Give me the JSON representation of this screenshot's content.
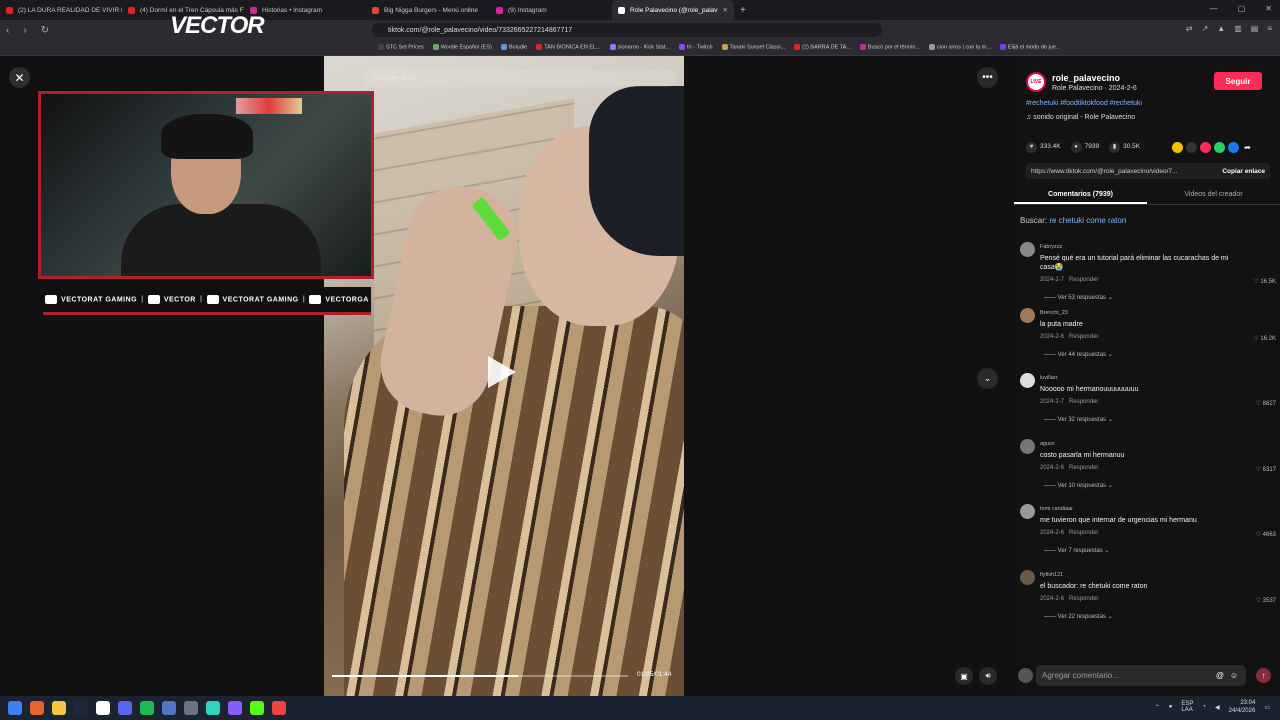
{
  "browser": {
    "tabs": [
      {
        "label": "(2) LA DURA REALIDAD DE VIVIR EN",
        "color": "#e02424"
      },
      {
        "label": "(4) Dormí en el Tren Cápsula más Fu",
        "color": "#e02424"
      },
      {
        "label": "Historias • Instagram",
        "color": "#d6249f"
      },
      {
        "label": "Big Nigga Burgers - Menú online",
        "color": "#e0453a"
      },
      {
        "label": "(9) Instagram",
        "color": "#d6249f"
      },
      {
        "label": "Role Palavecino (@role_palav",
        "color": "#ffffff"
      }
    ],
    "url": "tiktok.com/@role_palavecino/video/7332665227214867717",
    "bookmarks": [
      {
        "label": "STC Set Prices",
        "color": "#444"
      },
      {
        "label": "Wordle Español (ES)",
        "color": "#6aaa64"
      },
      {
        "label": "Boludle",
        "color": "#5b9bd5"
      },
      {
        "label": "TAN BIONICA EN EL...",
        "color": "#e02424"
      },
      {
        "label": "sionaron - Kick Stat...",
        "color": "#8a7dff"
      },
      {
        "label": "trr - Twitch",
        "color": "#9146ff"
      },
      {
        "label": "Tanaki Sunset Classi...",
        "color": "#c8a24a"
      },
      {
        "label": "(2) BARRA DE TA...",
        "color": "#e02424"
      },
      {
        "label": "Buscó por el términ...",
        "color": "#d6249f"
      },
      {
        "label": "cion arros | con la m...",
        "color": "#999"
      },
      {
        "label": "Elijá el modo de jue...",
        "color": "#7c3aed"
      }
    ]
  },
  "overlay": {
    "brand": "VECTOR",
    "socials": [
      {
        "label": "VECTORAT GAMING"
      },
      {
        "label": "VECTOR"
      },
      {
        "label": "VECTORAT GAMING"
      },
      {
        "label": "VECTORGA"
      }
    ]
  },
  "video": {
    "search_text": "d come raton",
    "time": "01:05/01:44",
    "progress": 0.63
  },
  "panel": {
    "author": {
      "handle": "role_palavecino",
      "subtitle": "Role Palavecino · 2024-2-6",
      "follow_label": "Seguir",
      "logo_text": "LIVE"
    },
    "hashtags": "#rechetuki #foodtiktokfood #rechetuki",
    "sound": "♫  sonido original - Role Palavecino",
    "likes": "333.4K",
    "comments_count": "7939",
    "saves": "30.5K",
    "link": "https://www.tiktok.com/@role_palavecino/video/7...",
    "copy_label": "Copiar enlace",
    "tab_comments": "Comentarios (7939)",
    "tab_videos": "Videos del creador",
    "find_label": "Buscar:",
    "find_query": "re chetuki come raton",
    "comments": [
      {
        "user": "Fabryzzz",
        "text": "Pensé qué era un tutorial pará eliminar las cucarachas de mi casa😭",
        "date": "2024-2-7",
        "reply": "Responder",
        "likes": "16.5K",
        "replies": "Ver 53 respuestas"
      },
      {
        "user": "Brenchi_23",
        "text": "la puta madre",
        "date": "2024-2-6",
        "reply": "Responder",
        "likes": "16.2K",
        "replies": "Ver 44 respuestas"
      },
      {
        "user": "luvillarr",
        "text": "Nooooo mi hermanouuuuuuuuu",
        "date": "2024-2-7",
        "reply": "Responder",
        "likes": "8827",
        "replies": "Ver 32 respuestas"
      },
      {
        "user": "aguss",
        "text": "costo pasarla mi hermanuu",
        "date": "2024-2-6",
        "reply": "Responder",
        "likes": "6317",
        "replies": "Ver 10 respuestas"
      },
      {
        "user": "tomi candiaar",
        "text": "me tuvieron que internar de urgencias mi hermanu",
        "date": "2024-2-6",
        "reply": "Responder",
        "likes": "4663",
        "replies": "Ver 7 respuestas"
      },
      {
        "user": "flyfish121",
        "text": "el buscador: re chetuki come raton",
        "date": "2024-2-6",
        "reply": "Responder",
        "likes": "3537",
        "replies": "Ver 22 respuestas"
      }
    ],
    "comment_placeholder": "Agregar comentario..."
  },
  "taskbar": {
    "lang": "ESP\nLAA",
    "time": "23:04",
    "date": "24/4/2026"
  }
}
